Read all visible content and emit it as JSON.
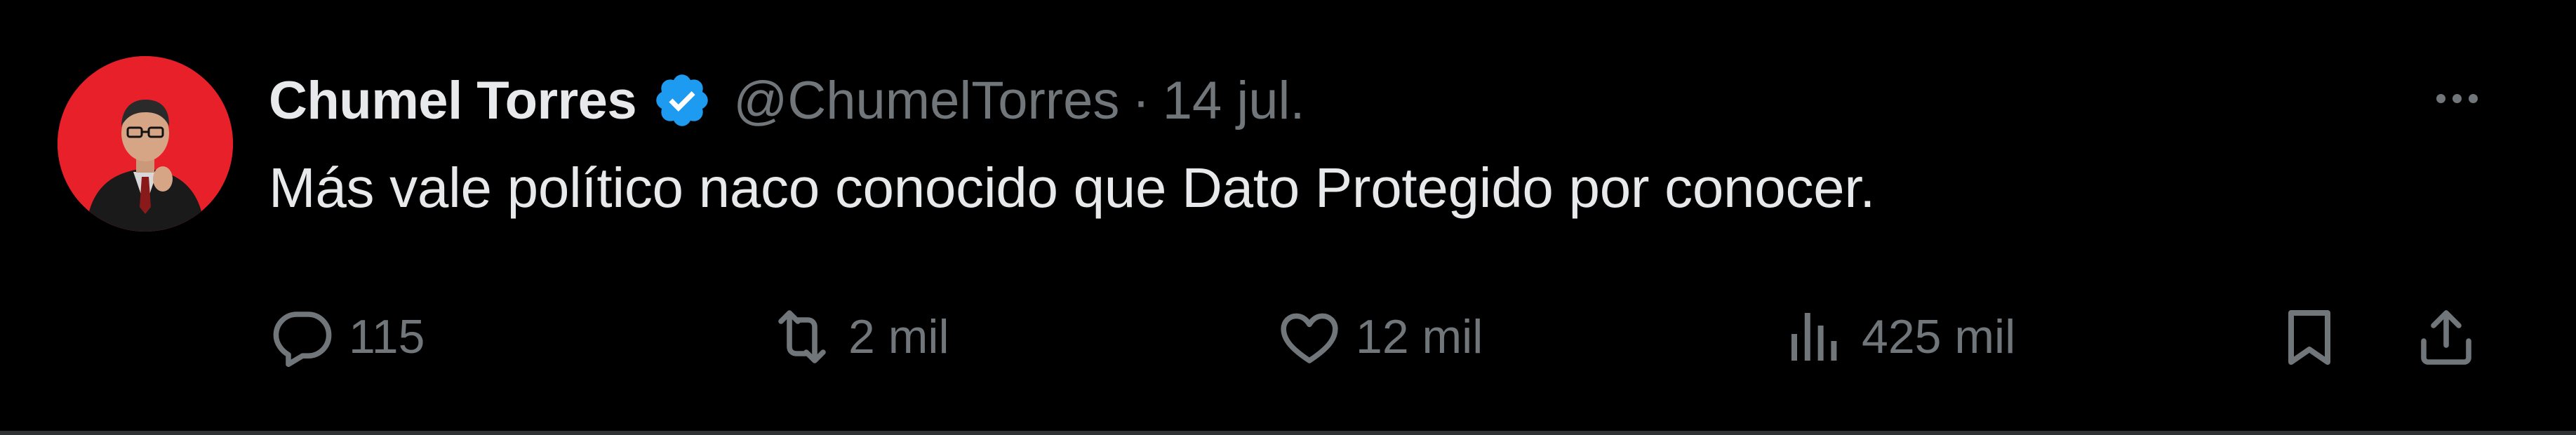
{
  "tweet": {
    "display_name": "Chumel Torres",
    "handle": "@ChumelTorres",
    "separator": "·",
    "date": "14 jul.",
    "text": "Más vale político naco conocido que Dato Protegido por conocer.",
    "verified": true
  },
  "actions": {
    "replies": "115",
    "retweets": "2 mil",
    "likes": "12 mil",
    "views": "425 mil"
  },
  "icons": {
    "reply": "speech-bubble-icon",
    "retweet": "retweet-arrows-icon",
    "like": "heart-icon",
    "views": "bar-chart-icon",
    "bookmark": "bookmark-icon",
    "share": "share-upload-icon",
    "more": "more-dots-icon",
    "verified": "verified-badge-icon"
  },
  "colors": {
    "background": "#000000",
    "primary_text": "#e7e9ea",
    "secondary_text": "#71767b",
    "verified_blue": "#1d9bf0",
    "avatar_bg": "#e8202a"
  }
}
